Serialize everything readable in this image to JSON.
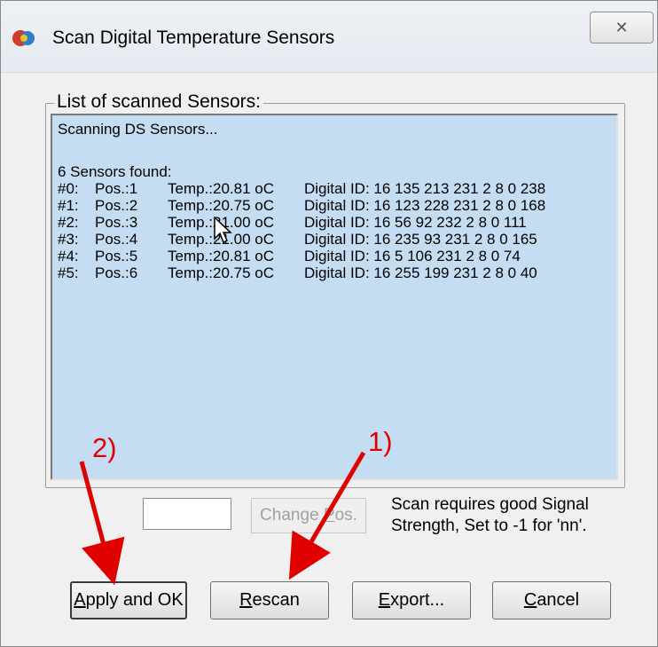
{
  "window": {
    "title": "Scan Digital Temperature Sensors",
    "close_glyph": "✕",
    "icon": "app-sensor-icon"
  },
  "group": {
    "label": "List of scanned Sensors:",
    "status": "Scanning DS Sensors...",
    "found": "6 Sensors found:",
    "rows": [
      {
        "id": "#0:",
        "pos": "Pos.:1",
        "temp": "Temp.:20.81 oC",
        "digital": "Digital ID: 16 135 213 231 2 8 0 238"
      },
      {
        "id": "#1:",
        "pos": "Pos.:2",
        "temp": "Temp.:20.75 oC",
        "digital": "Digital ID: 16 123 228 231 2 8 0 168"
      },
      {
        "id": "#2:",
        "pos": "Pos.:3",
        "temp": "Temp.:21.00 oC",
        "digital": "Digital ID: 16 56 92 232 2 8 0 111"
      },
      {
        "id": "#3:",
        "pos": "Pos.:4",
        "temp": "Temp.:21.00 oC",
        "digital": "Digital ID: 16 235 93 231 2 8 0 165"
      },
      {
        "id": "#4:",
        "pos": "Pos.:5",
        "temp": "Temp.:20.81 oC",
        "digital": "Digital ID: 16 5 106 231 2 8 0 74"
      },
      {
        "id": "#5:",
        "pos": "Pos.:6",
        "temp": "Temp.:20.75 oC",
        "digital": "Digital ID: 16 255 199 231 2 8 0 40"
      }
    ]
  },
  "position_field": {
    "value": ""
  },
  "change_pos": {
    "prefix": "Change ",
    "accel": "P",
    "suffix": "os."
  },
  "hint": {
    "line1": "Scan requires good Signal",
    "line2": "Strength, Set to -1 for 'nn'."
  },
  "buttons": {
    "apply": {
      "accel": "A",
      "rest": "pply and OK"
    },
    "rescan": {
      "accel": "R",
      "rest": "escan"
    },
    "export": {
      "accel": "E",
      "rest": "xport..."
    },
    "cancel": {
      "accel": "C",
      "rest": "ancel"
    }
  },
  "annotations": {
    "label_1": "1)",
    "label_2": "2)",
    "color": "#e00000"
  },
  "colors": {
    "list_background": "#c5ddf3",
    "window_background": "#f0f0f0"
  }
}
